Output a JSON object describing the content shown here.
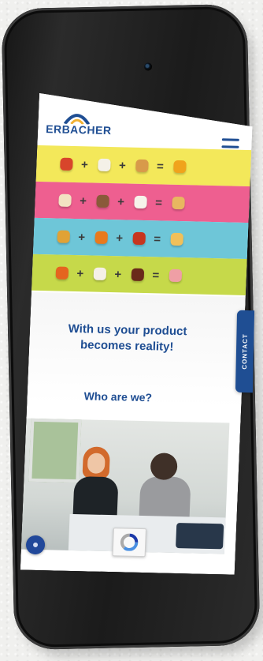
{
  "header": {
    "logo_text": "ERBACHER",
    "logo_arc_colors": [
      "#1f4e93",
      "#f2b233"
    ]
  },
  "strips": [
    {
      "color": "#f3e85a",
      "operators": [
        "+",
        "+",
        "="
      ],
      "items": [
        "#d8452b",
        "#f4f1e8",
        "#d89a4a",
        "#f0a31c"
      ]
    },
    {
      "color": "#ee5f90",
      "operators": [
        "+",
        "+",
        "="
      ],
      "items": [
        "#f2e3c2",
        "#8a5a3a",
        "#f6f2ea",
        "#e8b760"
      ]
    },
    {
      "color": "#6ec6d8",
      "operators": [
        "+",
        "+",
        "="
      ],
      "items": [
        "#e0a236",
        "#e97a1c",
        "#c7351f",
        "#f0c05a"
      ]
    },
    {
      "color": "#c6d94a",
      "operators": [
        "+",
        "+",
        "="
      ],
      "items": [
        "#e5641f",
        "#f5f0e6",
        "#6a2a1a",
        "#ef9fa5"
      ]
    }
  ],
  "hero": {
    "tagline": "With us your product becomes reality!",
    "section_title": "Who are we?"
  },
  "contact_tab": {
    "label": "CONTACT"
  },
  "colors": {
    "brand_blue": "#1f4e93",
    "phone_frame": "#1b1b1b"
  }
}
